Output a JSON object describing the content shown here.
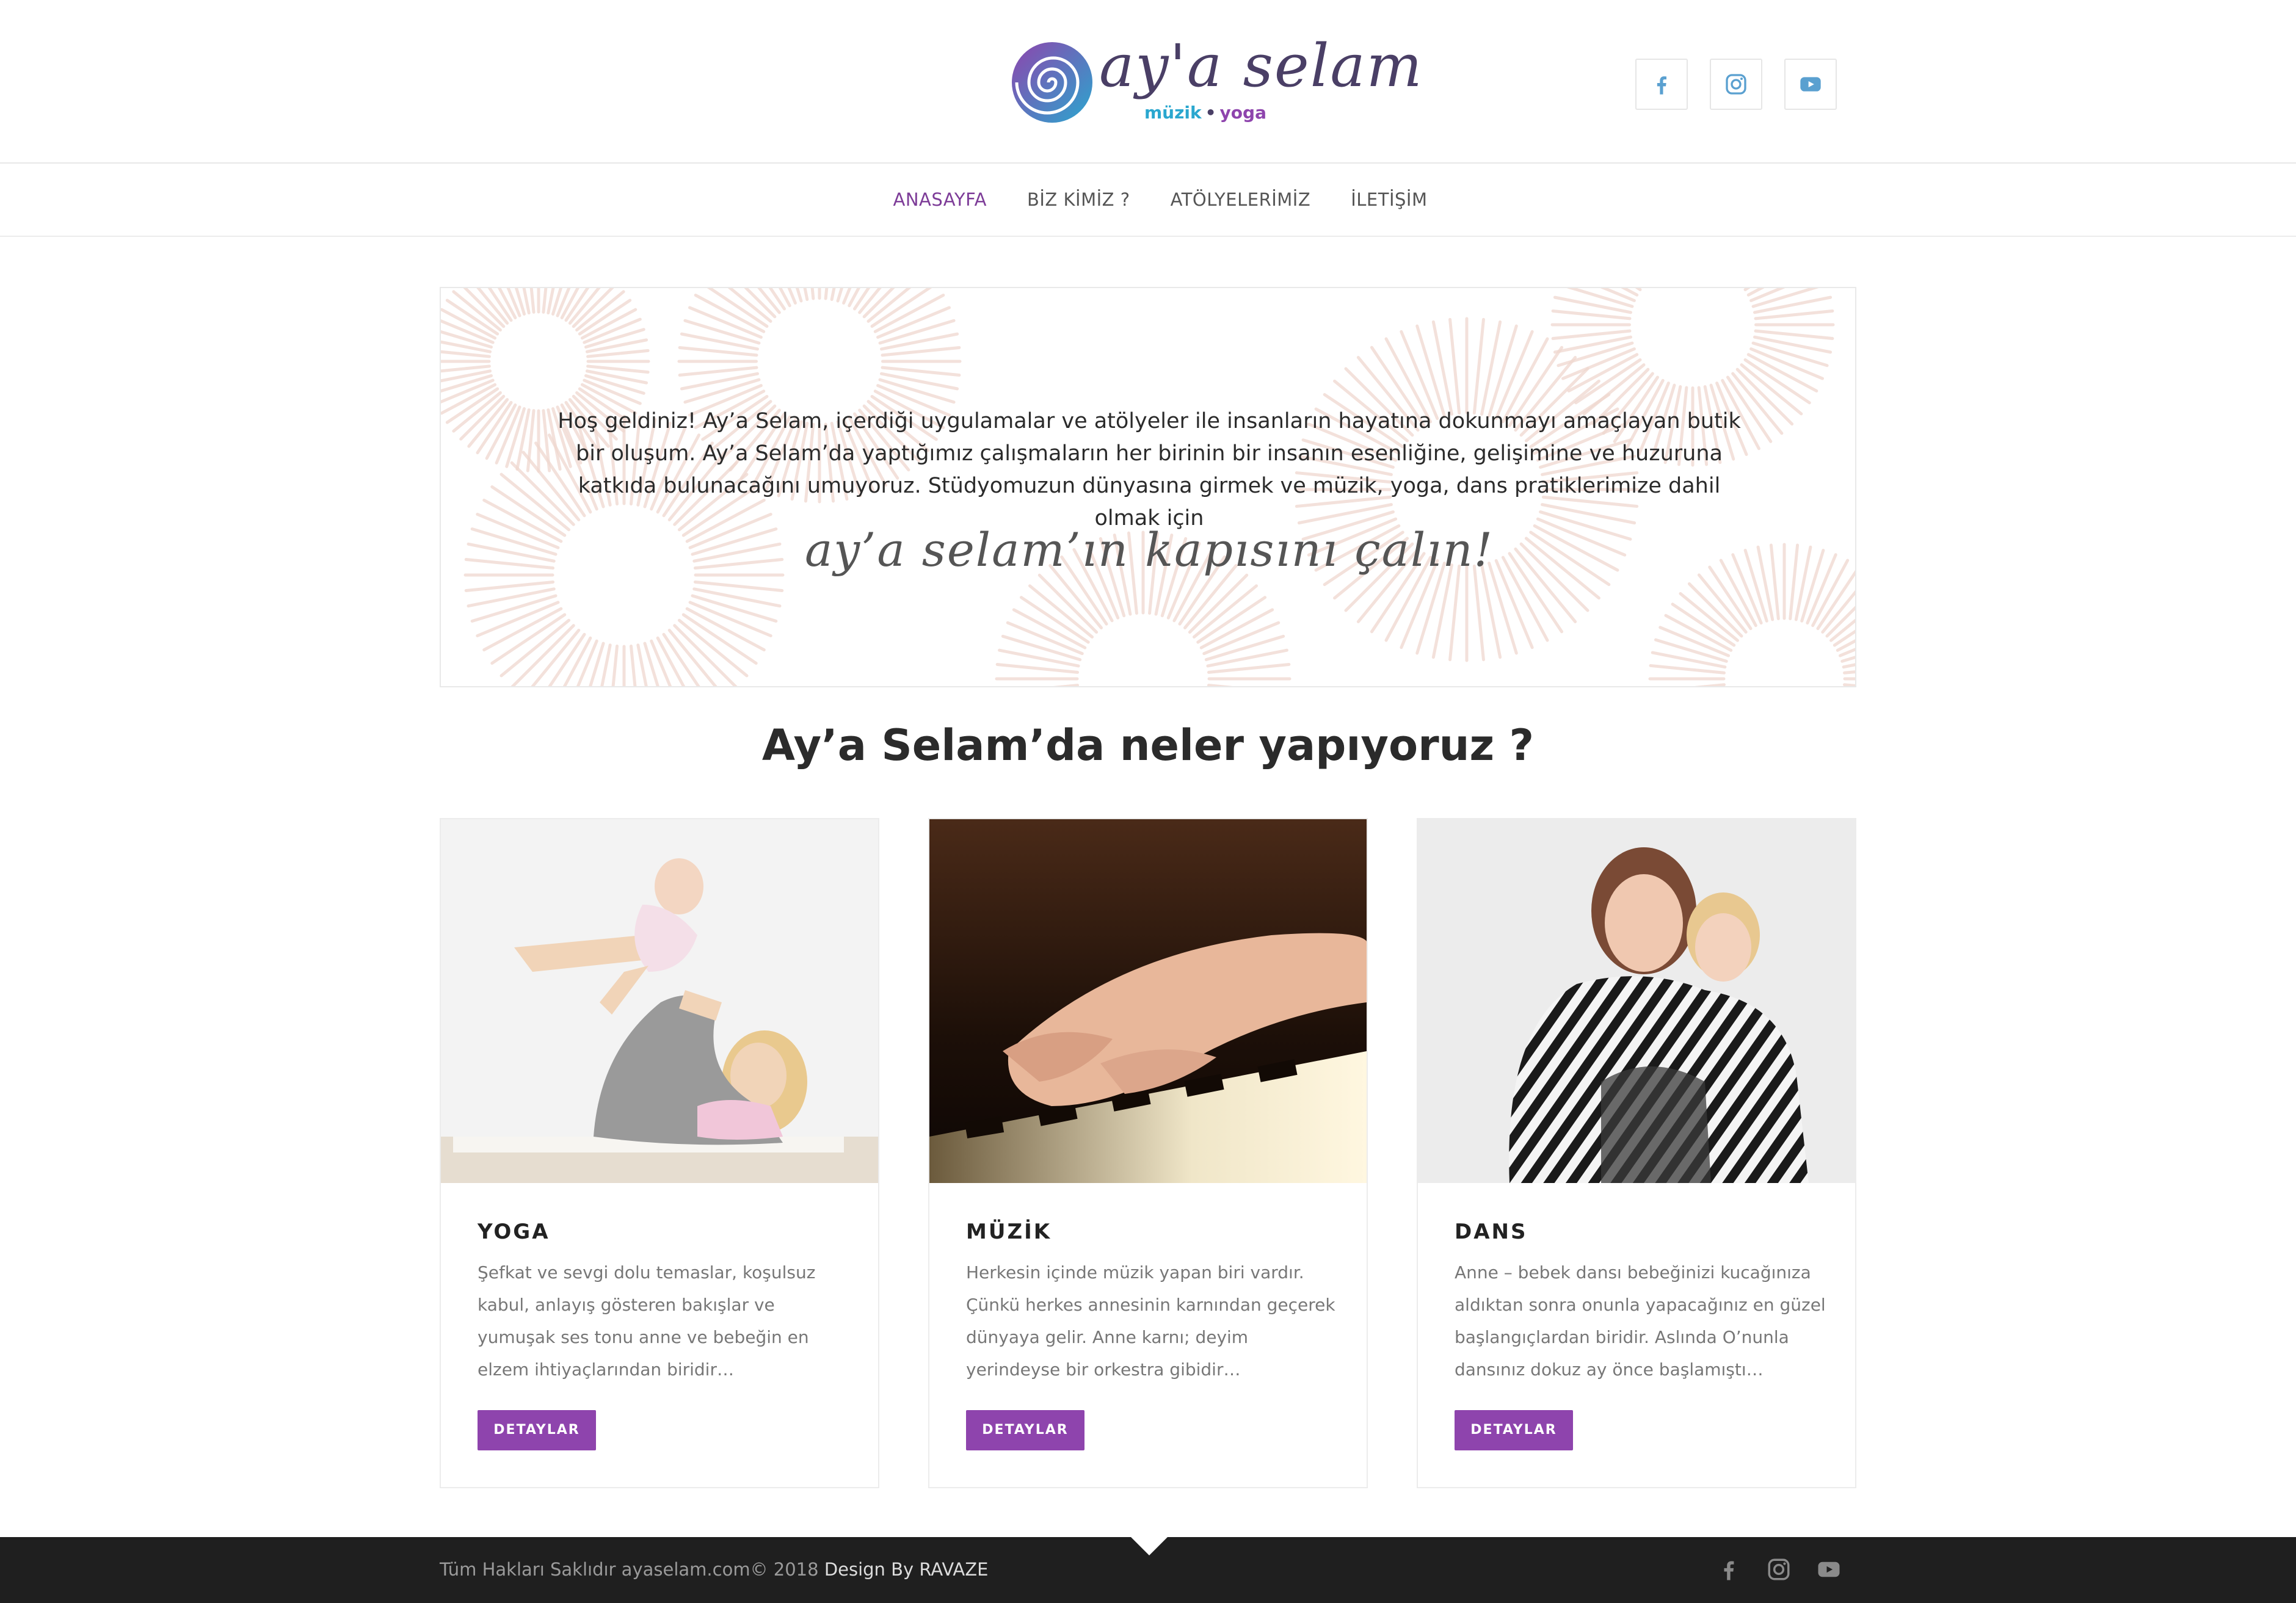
{
  "brand": {
    "name": "ay'a selam",
    "sub_muzik": "müzik",
    "sub_dot": "•",
    "sub_yoga": "yoga"
  },
  "social": [
    {
      "icon": "facebook-icon"
    },
    {
      "icon": "instagram-icon"
    },
    {
      "icon": "youtube-icon"
    }
  ],
  "nav": {
    "items": [
      {
        "label": "ANASAYFA",
        "active": true
      },
      {
        "label": "BİZ KİMİZ ?"
      },
      {
        "label": "ATÖLYELERİMİZ"
      },
      {
        "label": "İLETİŞİM"
      }
    ]
  },
  "banner": {
    "text": "Hoş geldiniz! Ay’a Selam, içerdiği uygulamalar ve atölyeler ile insanların hayatına dokunmayı amaçlayan butik bir oluşum. Ay’a Selam’da yaptığımız çalışmaların her birinin bir insanın esenliğine, gelişimine ve huzuruna katkıda bulunacağını umuyoruz. Stüdyomuzun dünyasına girmek ve müzik, yoga, dans pratiklerimize dahil olmak için",
    "script": "ay’a selam’ın kapısını çalın!"
  },
  "section": {
    "title_strong": "Ay’a Selam’da",
    "title_rest": " neler yapıyoruz ?"
  },
  "cards": [
    {
      "title": "YOGA",
      "text": "Şefkat ve sevgi dolu temaslar, koşulsuz kabul, anlayış gösteren bakışlar ve yumuşak ses tonu anne ve bebeğin en elzem ihtiyaçlarından biridir…",
      "button": "DETAYLAR"
    },
    {
      "title": "MÜZİK",
      "text": "Herkesin içinde müzik yapan biri vardır. Çünkü herkes annesinin karnından geçerek dünyaya gelir. Anne karnı; deyim yerindeyse bir orkestra gibidir…",
      "button": "DETAYLAR"
    },
    {
      "title": "DANS",
      "text": "Anne – bebek dansı bebeğinizi kucağınıza aldıktan sonra onunla yapacağınız en güzel başlangıçlardan biridir. Aslında O’nunla dansınız dokuz ay önce başlamıştı…",
      "button": "DETAYLAR"
    }
  ],
  "footer": {
    "copyright": "Tüm Hakları Saklıdır ayaselam.com© 2018 ",
    "design": "Design By RAVAZE"
  },
  "colors": {
    "accent": "#8e44ad",
    "nav_active": "#7d3c98",
    "footer_bg": "#1f1f1f",
    "social_icon": "#5aa0d0"
  }
}
